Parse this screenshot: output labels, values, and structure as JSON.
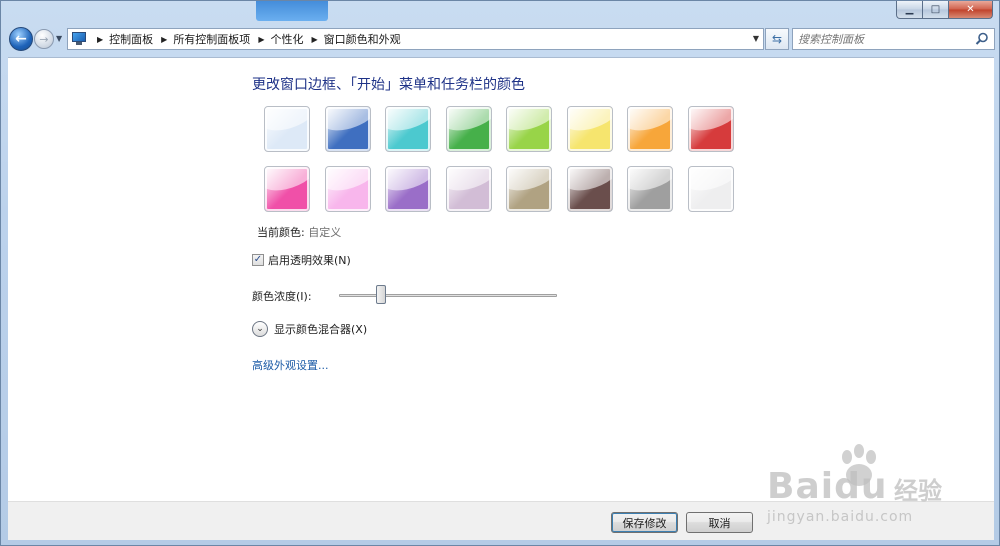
{
  "window": {
    "caption": {
      "minimize": "▁",
      "maximize": "□",
      "close": "✕"
    }
  },
  "nav": {
    "back_icon": "back-arrow-icon",
    "forward_icon": "forward-arrow-icon",
    "breadcrumbs": [
      "控制面板",
      "所有控制面板项",
      "个性化",
      "窗口颜色和外观"
    ],
    "search_placeholder": "搜索控制面板"
  },
  "main": {
    "title": "更改窗口边框、「开始」菜单和任务栏的颜色",
    "swatch_colors": [
      [
        "#dde9f7",
        "#3f6fc0",
        "#4cc9cf",
        "#46b04a",
        "#98d448",
        "#f6e56e",
        "#f7a63a",
        "#d63b3c"
      ],
      [
        "#f050a8",
        "#f8b6ec",
        "#9a6ec8",
        "#d2bdd6",
        "#b0a282",
        "#6a4e4c",
        "#9f9f9f",
        "#eeeeef"
      ]
    ],
    "current_color_label": "当前颜色:",
    "current_color_value": "自定义",
    "transparency_checked_mark": "✓",
    "transparency_label": "启用透明效果(N)",
    "intensity_label": "颜色浓度(I):",
    "intensity_value": 0.17,
    "mixer_label": "显示颜色混合器(X)",
    "advanced_link": "高级外观设置..."
  },
  "footer": {
    "save_label": "保存修改",
    "cancel_label": "取消"
  },
  "watermark": {
    "text": "Bai",
    "text2": "du",
    "cn": "经验",
    "url": "jingyan.baidu.com"
  }
}
